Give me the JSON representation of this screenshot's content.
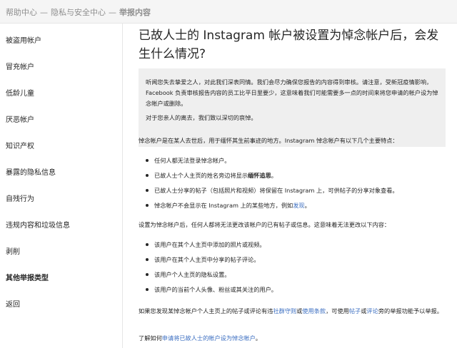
{
  "breadcrumb": {
    "items": [
      "帮助中心",
      "隐私与安全中心",
      "举报内容"
    ],
    "separator": "—"
  },
  "sidebar": {
    "items": [
      {
        "label": "被盗用帐户"
      },
      {
        "label": "冒充帐户"
      },
      {
        "label": "低龄儿童"
      },
      {
        "label": "厌恶帐户"
      },
      {
        "label": "知识产权"
      },
      {
        "label": "暴露的隐私信息"
      },
      {
        "label": "自残行为"
      },
      {
        "label": "违规内容和垃圾信息"
      },
      {
        "label": "剥削"
      },
      {
        "label": "其他举报类型"
      },
      {
        "label": "返回"
      }
    ],
    "active_index": 9
  },
  "article": {
    "title": "已故人士的 Instagram 帐户被设置为悼念帐户后，会发生什么情况?",
    "notice": {
      "p1": "听闻您失去挚爱之人，对此我们深表同情。我们会尽力确保您报告的内容得到审核。请注意，受新冠疫情影响，Facebook 负责审核报告内容的员工比平日里要少，这意味着我们可能需要多一点的时间来将您申请的帐户设为悼念帐户或删除。",
      "p2": "对于您亲人的离去，我们致以深切的哀悼。"
    },
    "intro": "悼念帐户是在某人去世后，用于缅怀其生前事迹的地方。Instagram 悼念帐户有以下几个主要特点：",
    "features": [
      {
        "text": "任何人都无法登录悼念帐户。"
      },
      {
        "text_before": "已故人士个人主页的姓名旁边将显示",
        "bold": "缅怀追思",
        "text_after": "。"
      },
      {
        "text": "已故人士分享的帖子（包括照片和视频）将保留在 Instagram 上，可供帖子的分享对象查看。"
      },
      {
        "text_before": "悼念帐户不会显示在 Instagram 上的某些地方，例如",
        "link": "发现",
        "text_after": "。"
      }
    ],
    "cannot_change_intro": "设置为悼念帐户后，任何人都将无法更改该帐户的已有帖子或信息。这意味着无法更改以下内容：",
    "cannot_change": [
      "该用户在其个人主页中添加的照片或视频。",
      "该用户在其个人主页中分享的帖子评论。",
      "该用户个人主页的隐私设置。",
      "该用户的当前个人头像、粉丝或其关注的用户。"
    ],
    "report_para": {
      "t1": "如果您发现某悼念帐户个人主页上的帖子或评论有违",
      "l1": "社群守则",
      "t2": "或",
      "l2": "使用条款",
      "t3": "，可使用",
      "l3": "帖子",
      "t4": "或",
      "l4": "评论",
      "t5": "旁的举报功能予以举报。"
    },
    "learn_more": {
      "prefix": "了解如何",
      "link": "申请将已故人士的帐户设为悼念帐户",
      "suffix": "。"
    }
  },
  "colors": {
    "link": "#3b6ec1",
    "notice_bg": "#efefef",
    "topbar_bg": "#f5f5f5"
  }
}
